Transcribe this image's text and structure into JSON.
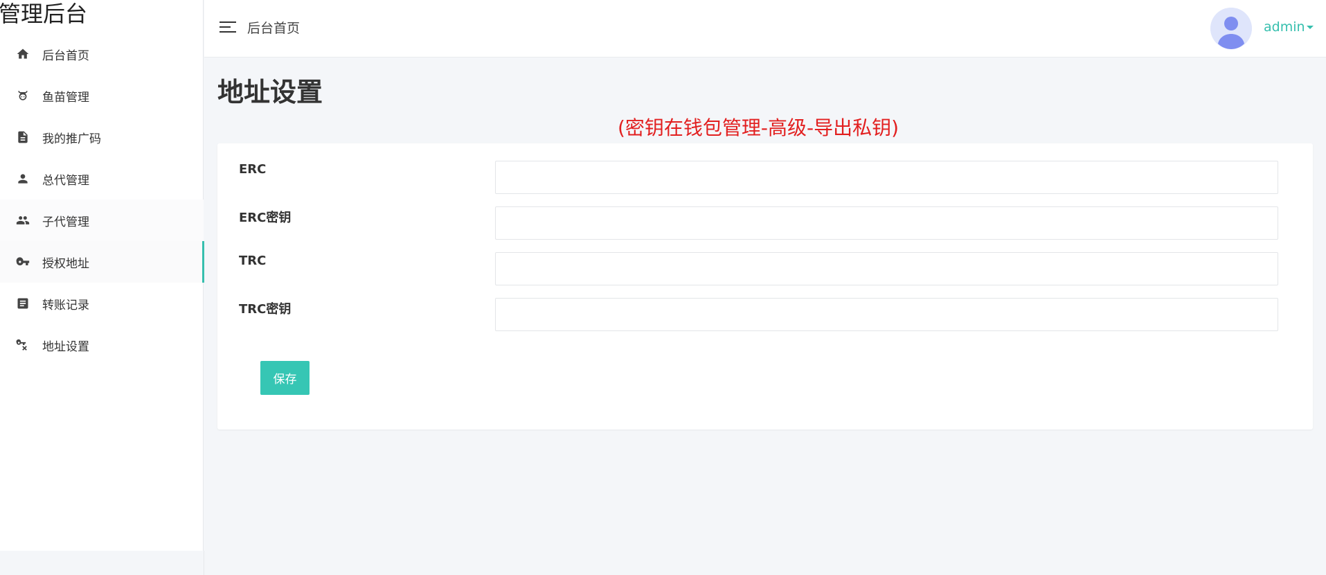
{
  "brand": {
    "title": "管理后台"
  },
  "sidebar": {
    "items": [
      {
        "label": "后台首页",
        "icon": "home-icon"
      },
      {
        "label": "鱼苗管理",
        "icon": "cow-icon"
      },
      {
        "label": "我的推广码",
        "icon": "document-icon"
      },
      {
        "label": "总代管理",
        "icon": "person-icon"
      },
      {
        "label": "子代管理",
        "icon": "people-icon"
      },
      {
        "label": "授权地址",
        "icon": "key-icon"
      },
      {
        "label": "转账记录",
        "icon": "list-icon"
      },
      {
        "label": "地址设置",
        "icon": "key-setting-icon"
      }
    ],
    "active_item": "授权地址"
  },
  "header": {
    "breadcrumb": "后台首页",
    "user": {
      "name": "admin"
    }
  },
  "main": {
    "page_title": "地址设置",
    "notice": "(密钥在钱包管理-高级-导出私钥)",
    "form": {
      "fields": [
        {
          "label": "ERC",
          "value": "",
          "placeholder": ""
        },
        {
          "label": "ERC密钥",
          "value": "",
          "placeholder": ""
        },
        {
          "label": "TRC",
          "value": "",
          "placeholder": ""
        },
        {
          "label": "TRC密钥",
          "value": "",
          "placeholder": ""
        }
      ],
      "save_label": "保存"
    }
  },
  "colors": {
    "accent": "#36bfae",
    "button": "#36c6b4",
    "notice": "#e21f1f",
    "background": "#f4f6f9"
  }
}
